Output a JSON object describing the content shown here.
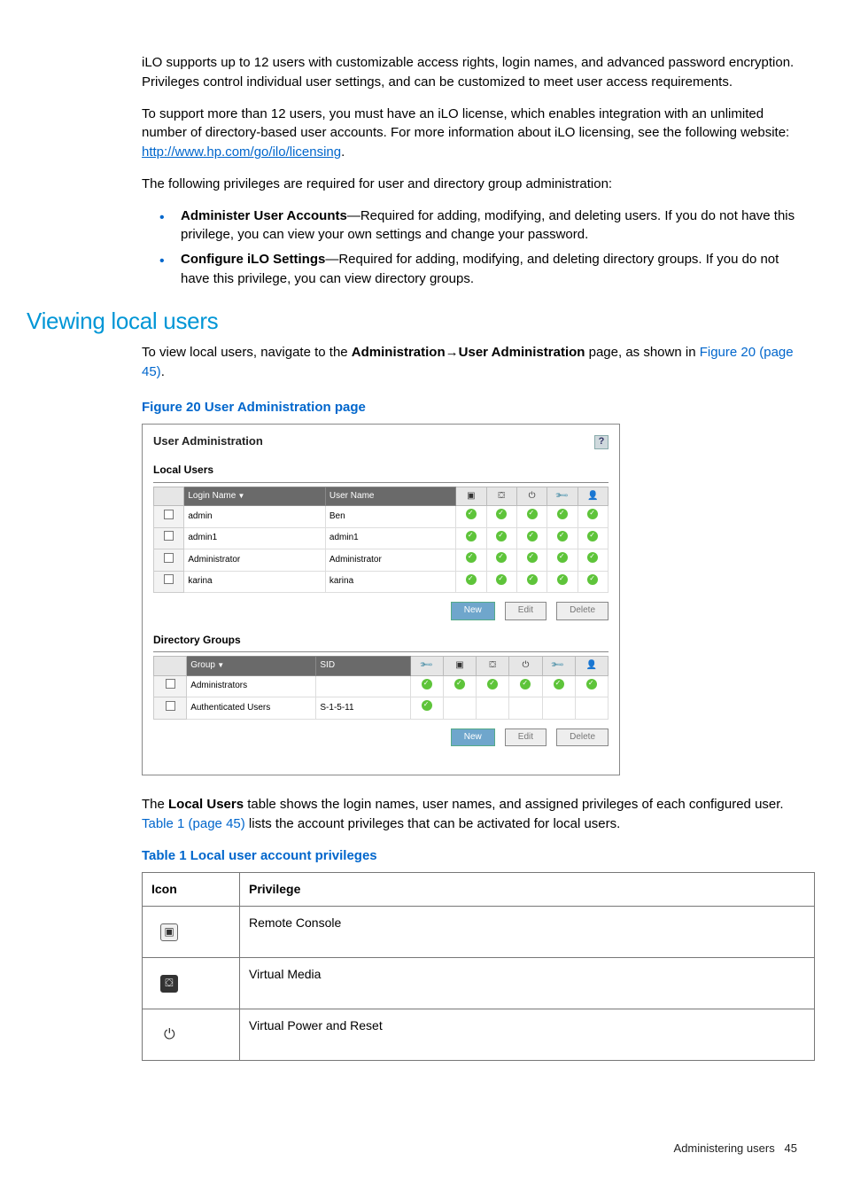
{
  "paragraphs": {
    "p1": "iLO supports up to 12 users with customizable access rights, login names, and advanced password encryption. Privileges control individual user settings, and can be customized to meet user access requirements.",
    "p2a": "To support more than 12 users, you must have an iLO license, which enables integration with an unlimited number of directory-based user accounts. For more information about iLO licensing, see the following website: ",
    "p2_link": "http://www.hp.com/go/ilo/licensing",
    "p2b": ".",
    "p3": "The following privileges are required for user and directory group administration:",
    "b1_strong": "Administer User Accounts",
    "b1_rest": "—Required for adding, modifying, and deleting users. If you do not have this privilege, you can view your own settings and change your password.",
    "b2_strong": "Configure iLO Settings",
    "b2_rest": "—Required for adding, modifying, and deleting directory groups. If you do not have this privilege, you can view directory groups.",
    "view_a": "To view local users, navigate to the ",
    "view_b": "Administration",
    "view_c": "→",
    "view_d": "User Administration",
    "view_e": " page, as shown in ",
    "view_f": "Figure 20 (page 45)",
    "view_g": ".",
    "post_a": "The ",
    "post_b": "Local Users",
    "post_c": " table shows the login names, user names, and assigned privileges of each configured user. ",
    "post_d": "Table 1 (page 45)",
    "post_e": " lists the account privileges that can be activated for local users."
  },
  "section_heading": "Viewing local users",
  "figure_caption": "Figure 20 User Administration page",
  "table_caption": "Table 1 Local user account privileges",
  "ua": {
    "title": "User Administration",
    "help": "?",
    "local_users_label": "Local Users",
    "directory_groups_label": "Directory Groups",
    "cols": {
      "login": "Login Name",
      "user": "User Name",
      "group": "Group",
      "sid": "SID"
    },
    "users": [
      {
        "login": "admin",
        "user": "Ben"
      },
      {
        "login": "admin1",
        "user": "admin1"
      },
      {
        "login": "Administrator",
        "user": "Administrator"
      },
      {
        "login": "karina",
        "user": "karina"
      }
    ],
    "groups": [
      {
        "group": "Administrators",
        "sid": "",
        "full": true
      },
      {
        "group": "Authenticated Users",
        "sid": "S-1-5-11",
        "full": false
      }
    ],
    "buttons": {
      "new": "New",
      "edit": "Edit",
      "delete": "Delete"
    }
  },
  "priv_table": {
    "head_icon": "Icon",
    "head_priv": "Privilege",
    "rows": [
      {
        "priv": "Remote Console",
        "icon": "monitor"
      },
      {
        "priv": "Virtual Media",
        "icon": "disk"
      },
      {
        "priv": "Virtual Power and Reset",
        "icon": "power"
      }
    ]
  },
  "footer": {
    "label": "Administering users",
    "page": "45"
  }
}
